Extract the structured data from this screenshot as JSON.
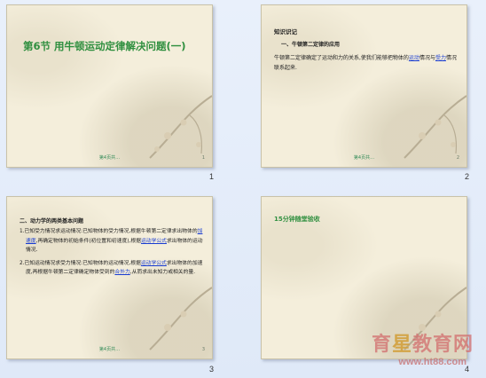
{
  "slides": [
    {
      "index": "1",
      "title": "第6节  用牛顿运动定律解决问题(一)",
      "footer_mid": "第4页共…",
      "footer_num": "1"
    },
    {
      "index": "2",
      "heading": "知识识记",
      "subheading": "一、牛顿第二定律的应用",
      "body_before": "牛顿第二定律确定了运动和力的关系,使我们能够把物体的",
      "link1": "运动",
      "body_mid": "情况与",
      "link2": "受力",
      "body_after": "情况联系起来.",
      "footer_mid": "第4页共…",
      "footer_num": "2"
    },
    {
      "index": "3",
      "heading": "二、动力学的两类基本问题",
      "p1_before": "1.已知受力情况求运动情况:已知物体的受力情况,根据牛顿第二定律求出物体的",
      "p1_link1": "加速度",
      "p1_mid": ",再确定物体的初始条件(初位置和初速度),根据",
      "p1_link2": "运动学公式",
      "p1_after": "求出物体的运动情况.",
      "p2_before": "2.已知运动情况求受力情况:已知物体的运动情况,根据",
      "p2_link1": "运动学公式",
      "p2_mid": "求出物体的加速度,再根据牛顿第二定律确定物体受到的",
      "p2_link2": "合外力",
      "p2_after": ",从而求出未知力或相关的量.",
      "footer_mid": "第4页共…",
      "footer_num": "3"
    },
    {
      "index": "4",
      "title": "15分钟随堂验收",
      "footer_mid": "",
      "footer_num": ""
    }
  ],
  "watermark": {
    "text_a": "育",
    "text_b": "星",
    "text_c": "教育网",
    "url": "www.ht88.com"
  },
  "colors": {
    "slide_bg": "#f4eedb",
    "title_green": "#2f8f3f",
    "link_blue": "#1a3dd1",
    "panel_bg": "#e9f0fb"
  }
}
